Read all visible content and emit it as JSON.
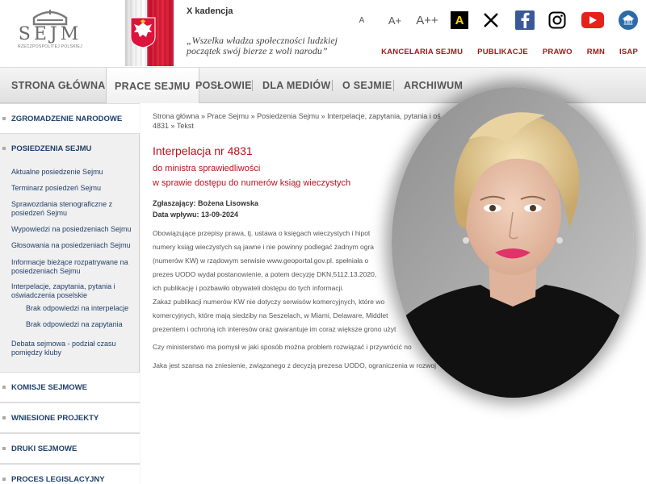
{
  "header": {
    "logo_text": "SEJM",
    "logo_sub": "RZECZPOSPOLITEJ POLSKIEJ",
    "kadencja": "X kadencja",
    "motto_line1": "„Wszelka władza społeczności ludzkiej",
    "motto_line2": "początek swój bierze z woli narodu”",
    "font_small": "A",
    "font_mid": "A+",
    "font_big": "A++",
    "contrast": "A",
    "topnav": [
      "KANCELARIA SEJMU",
      "PUBLIKACJE",
      "PRAWO",
      "RMN",
      "ISAP"
    ],
    "colors": {
      "accent_red": "#b8121c",
      "nav_red": "#9b1a1a",
      "link_blue": "#1f3f6b",
      "flag_red": "#c8102e"
    },
    "icons": [
      "x-icon",
      "facebook-icon",
      "instagram-icon",
      "youtube-icon",
      "bip-icon"
    ]
  },
  "mainnav": {
    "items": [
      "STRONA GŁÓWNA",
      "PRACE SEJMU",
      "POSŁOWIE",
      "DLA MEDIÓW",
      "O SEJMIE",
      "ARCHIWUM"
    ],
    "active": "PRACE SEJMU"
  },
  "sidebar": {
    "zgromadzenie": "ZGROMADZENIE NARODOWE",
    "posiedzenia": "POSIEDZENIA SEJMU",
    "links": [
      "Aktualne posiedzenie Sejmu",
      "Terminarz posiedzeń Sejmu",
      "Sprawozdania stenograficzne z posiedzeń Sejmu",
      "Wypowiedzi na posiedzeniach Sejmu",
      "Głosowania na posiedzeniach Sejmu",
      "Informacje bieżące rozpatrywane na posiedzeniach Sejmu",
      "Interpelacje, zapytania, pytania i oświadczenia poselskie"
    ],
    "sublinks": [
      "Brak odpowiedzi na interpelacje",
      "Brak odpowiedzi na zapytania"
    ],
    "debata": "Debata sejmowa - podział czasu pomiędzy kluby",
    "sections": [
      "KOMISJE SEJMOWE",
      "WNIESIONE PROJEKTY",
      "DRUKI SEJMOWE",
      "PROCES LEGISLACYJNY"
    ]
  },
  "content": {
    "breadcrumb_line1": "Strona główna  »  Prace Sejmu  »  Posiedzenia Sejmu  »  Interpelacje, zapytania, pytania i oś",
    "breadcrumb_line2": "4831  »  Tekst",
    "title": "Interpelacja nr 4831",
    "subtitle1": "do ministra sprawiedliwości",
    "subtitle2": "w sprawie dostępu do numerów ksiąg wieczystych",
    "zglaszajacy": "Zgłaszający: Bożena Lisowska",
    "data_wplywu": "Data wpływu: 13-09-2024",
    "para1": [
      "Obowiązujące przepisy prawa, tj. ustawa o księgach wieczystych i hipot",
      "numery ksiąg wieczystych są jawne i nie powinny podlegać żadnym ogra",
      "(numerów KW) w rządowym serwisie www.geoportal.gov.pl. spełniała o",
      "prezes UODO wydał postanowienie, a potem decyzję DKN.5112.13.2020,",
      "ich publikację i pozbawiło obywateli dostępu do tych informacji."
    ],
    "para2": [
      "Zakaz publikacji numerów KW nie dotyczy serwisów komercyjnych, które wo",
      "komercyjnych, które mają siedziby na Seszelach, w Miami, Delaware, Middlet",
      "prezentem i ochroną ich interesów oraz gwarantuje im coraz większe grono użyt"
    ],
    "para3": "Czy ministerstwo ma pomysł w jaki sposób można problem rozwiązać i przywrócić no",
    "para4": "Jaka jest szansa na zniesienie, związanego z decyzją prezesa UODO, ograniczenia w rozwoj"
  }
}
